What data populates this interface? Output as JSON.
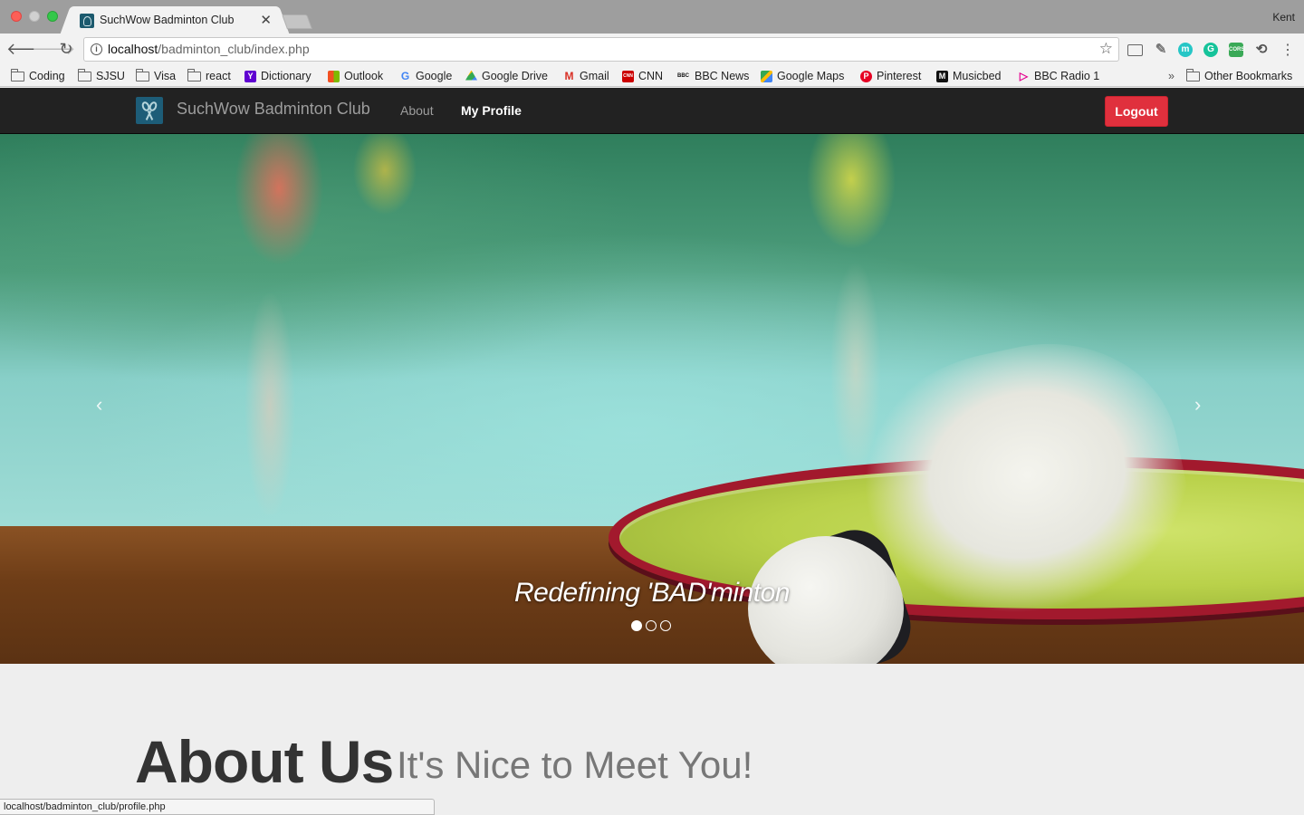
{
  "browser": {
    "tab_title": "SuchWow Badminton Club",
    "tab_close": "✕",
    "profile_name": "Kent",
    "url_host": "localhost",
    "url_path": "/badminton_club/index.php",
    "back_icon": "🡐",
    "forward_icon": "🡒",
    "reload_icon": "↻",
    "star_icon": "☆",
    "menu_icon": "⋮"
  },
  "extensions": {
    "m": "m",
    "g": "G",
    "cors": "CORS"
  },
  "bookmarks": {
    "items": [
      {
        "label": "Coding"
      },
      {
        "label": "SJSU"
      },
      {
        "label": "Visa"
      },
      {
        "label": "react"
      },
      {
        "label": "Dictionary",
        "glyph": "Y"
      },
      {
        "label": "Outlook"
      },
      {
        "label": "Google",
        "glyph": "G"
      },
      {
        "label": "Google Drive"
      },
      {
        "label": "Gmail",
        "glyph": "M"
      },
      {
        "label": "CNN",
        "glyph": "CNN"
      },
      {
        "label": "BBC News",
        "glyph": "BBC"
      },
      {
        "label": "Google Maps"
      },
      {
        "label": "Pinterest",
        "glyph": "P"
      },
      {
        "label": "Musicbed",
        "glyph": "M"
      },
      {
        "label": "BBC Radio 1"
      }
    ],
    "overflow": "»",
    "other": "Other Bookmarks"
  },
  "site_nav": {
    "brand": "SuchWow Badminton Club",
    "about": "About",
    "profile": "My Profile",
    "logout": "Logout"
  },
  "carousel": {
    "caption": "Redefining 'BAD'minton",
    "prev": "‹",
    "next": "›",
    "slide_count": 3,
    "active_slide": 1
  },
  "about": {
    "heading": "About Us",
    "subheading": "It's Nice to Meet You!"
  },
  "status_bar": {
    "text": "localhost/badminton_club/profile.php"
  }
}
